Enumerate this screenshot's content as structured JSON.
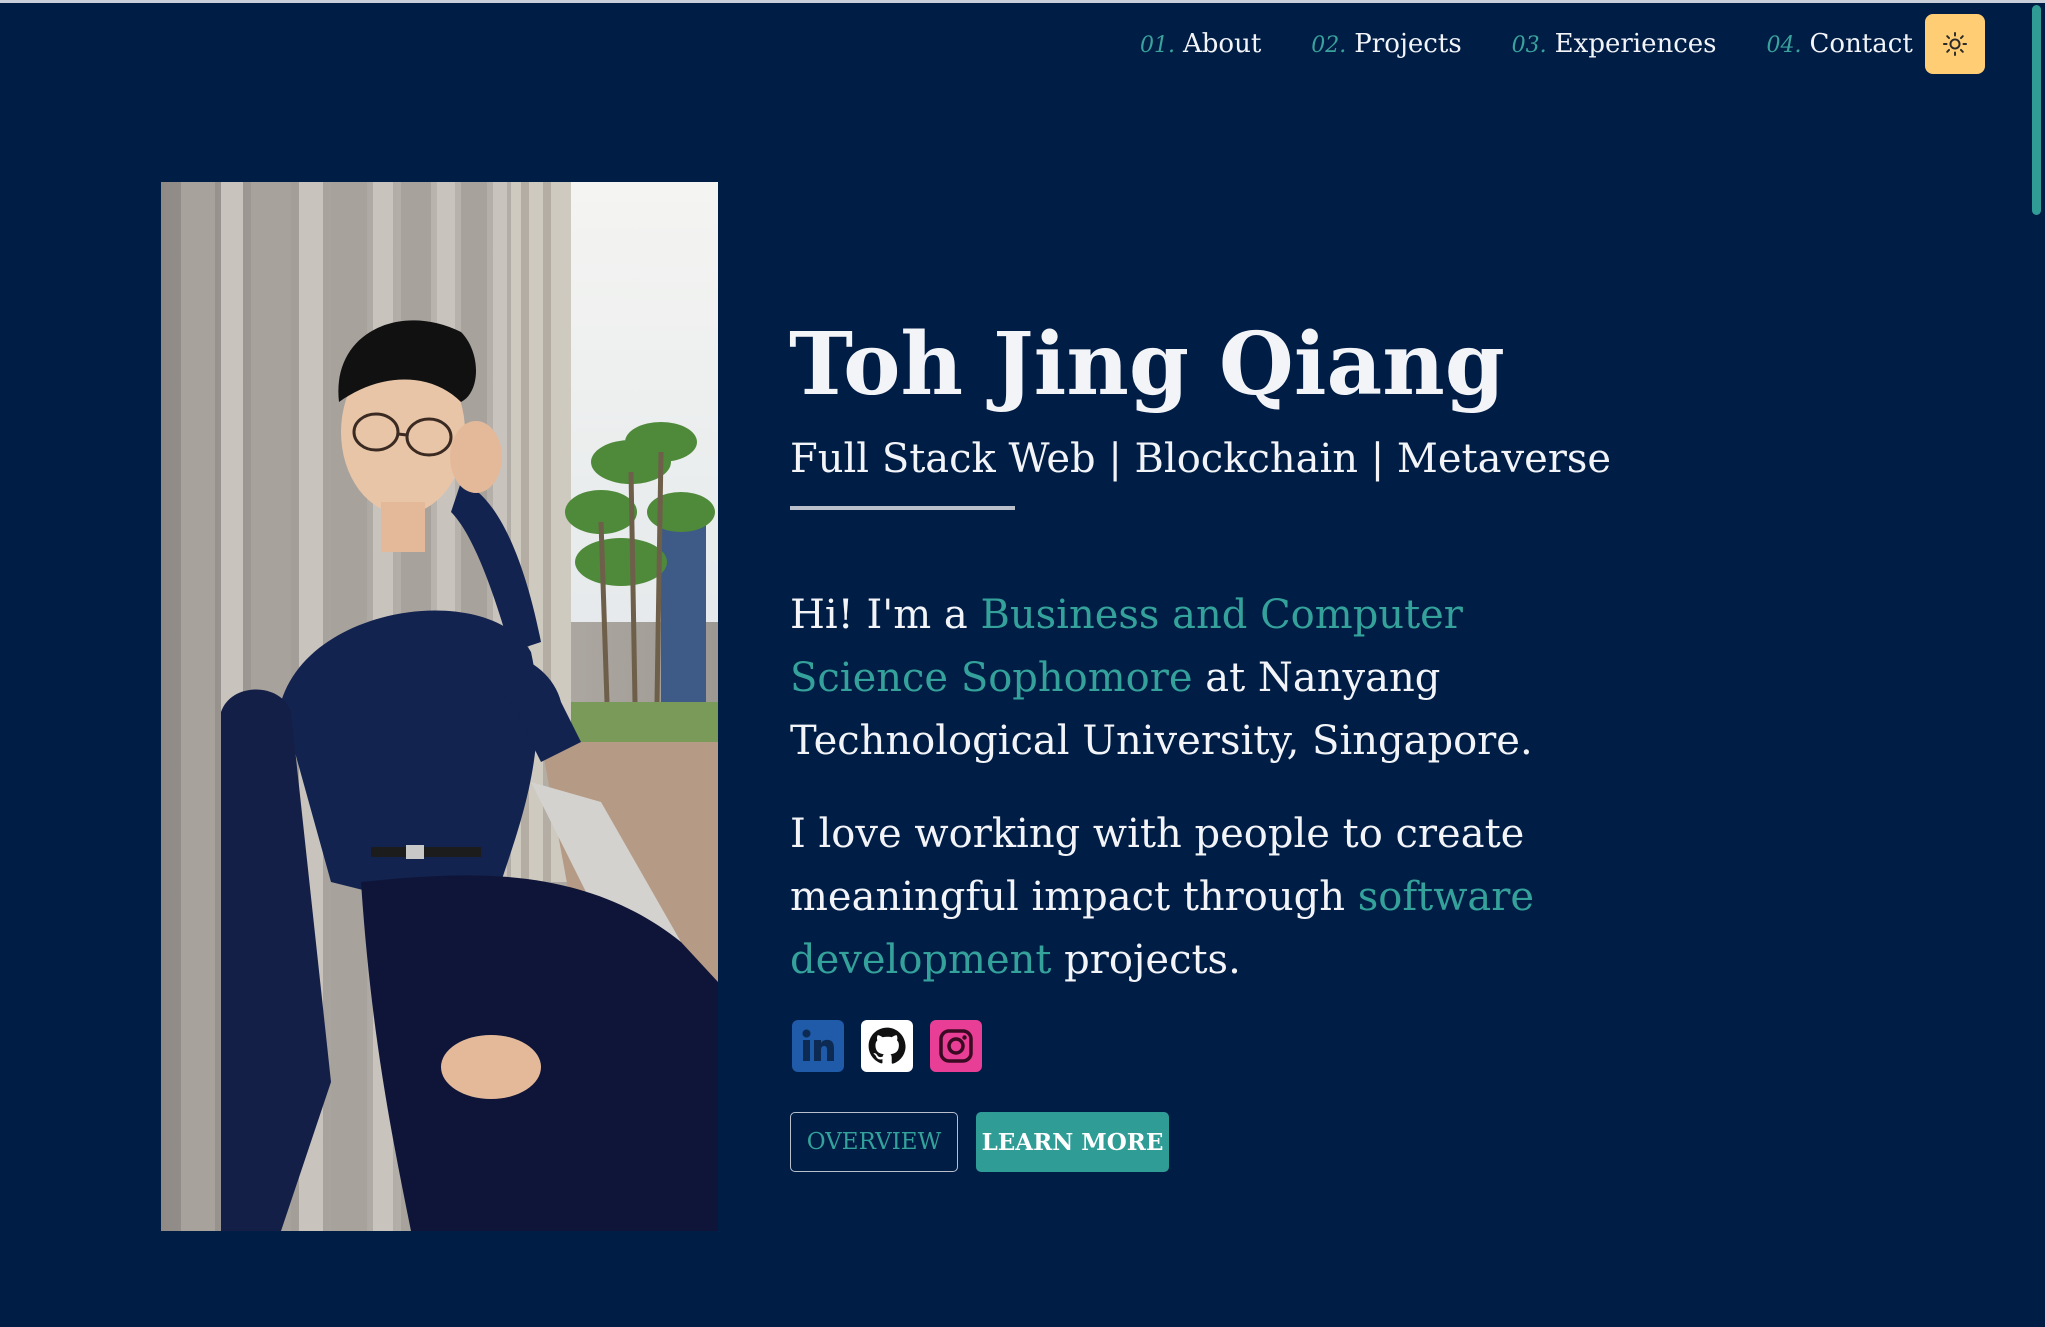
{
  "nav": {
    "items": [
      {
        "num": "01.",
        "label": "About"
      },
      {
        "num": "02.",
        "label": "Projects"
      },
      {
        "num": "03.",
        "label": "Experiences"
      },
      {
        "num": "04.",
        "label": "Contact"
      }
    ],
    "theme_toggle_icon": "sun-icon"
  },
  "hero": {
    "name": "Toh Jing Qiang",
    "tagline": "Full Stack Web | Blockchain | Metaverse",
    "intro": {
      "prefix": "Hi! I'm a ",
      "highlight": "Business and Computer Science Sophomore",
      "suffix": " at Nanyang Technological University, Singapore."
    },
    "mission": {
      "prefix": "I love working with people to create meaningful impact through ",
      "highlight": "software development",
      "suffix": " projects."
    }
  },
  "socials": [
    {
      "icon": "linkedin-icon",
      "color": "#1f5ba8"
    },
    {
      "icon": "github-icon",
      "color": "#ffffff"
    },
    {
      "icon": "instagram-icon",
      "color": "#e83e96"
    }
  ],
  "buttons": {
    "overview": "OVERVIEW",
    "learn_more": "LEARN MORE"
  },
  "colors": {
    "background": "#001d45",
    "accent": "#2f9c96",
    "toggle": "#ffcd74"
  }
}
